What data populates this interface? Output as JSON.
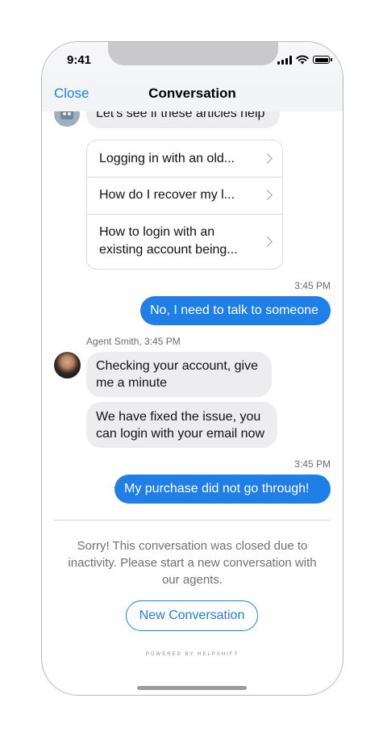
{
  "status_bar": {
    "time": "9:41",
    "icons": [
      "signal-icon",
      "wifi-icon",
      "battery-icon"
    ]
  },
  "nav": {
    "close_label": "Close",
    "title": "Conversation"
  },
  "messages": {
    "bot_partial": "Let's see if these articles help",
    "articles": [
      "Logging in with an old...",
      "How do I recover my l...",
      "How to login with an existing account being..."
    ],
    "user_1": {
      "time": "3:45 PM",
      "text": "No, I need to talk to someone"
    },
    "agent_header": "Agent Smith, 3:45 PM",
    "agent_1": "Checking your account, give me a minute",
    "agent_2": "We have fixed the issue, you can login with your email now",
    "user_2": {
      "time": "3:45 PM",
      "text": "My purchase did not go through!"
    }
  },
  "closed": {
    "message": "Sorry! This conversation was closed due to inactivity. Please start a new conversation with our agents.",
    "button_label": "New Conversation",
    "powered_by": "POWERED BY HELPSHIFT"
  },
  "colors": {
    "accent": "#1f7fe6",
    "incoming_bubble": "#ededf0",
    "outgoing_bubble": "#1f7fe6"
  }
}
